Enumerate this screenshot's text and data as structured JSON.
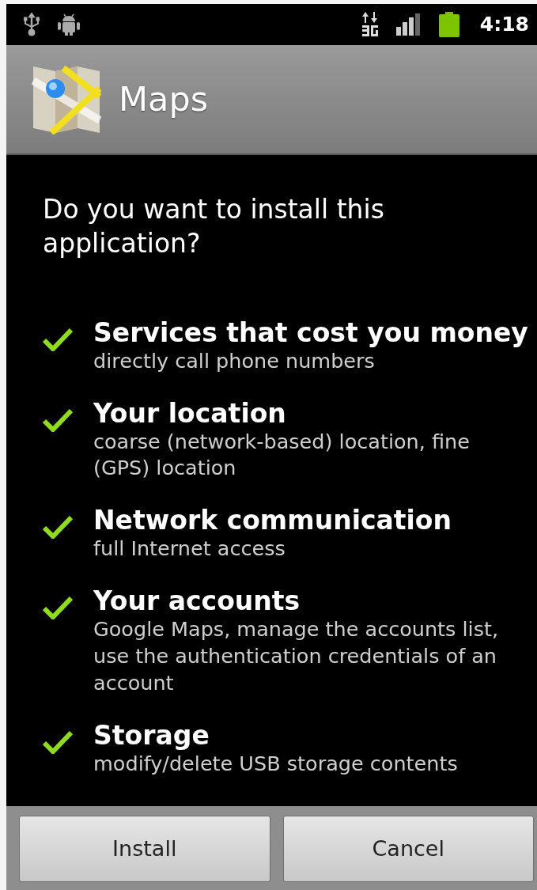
{
  "status_bar": {
    "time": "4:18"
  },
  "header": {
    "title": "Maps"
  },
  "question": "Do you want to install this application?",
  "permissions": [
    {
      "title": "Services that cost you money",
      "detail": "directly call phone numbers"
    },
    {
      "title": "Your location",
      "detail": "coarse (network-based) location, fine (GPS) location"
    },
    {
      "title": "Network communication",
      "detail": "full Internet access"
    },
    {
      "title": "Your accounts",
      "detail": "Google Maps, manage the accounts list, use the authentication credentials of an account"
    },
    {
      "title": "Storage",
      "detail": "modify/delete USB storage contents"
    }
  ],
  "buttons": [
    {
      "label": "Install"
    },
    {
      "label": "Cancel"
    }
  ]
}
